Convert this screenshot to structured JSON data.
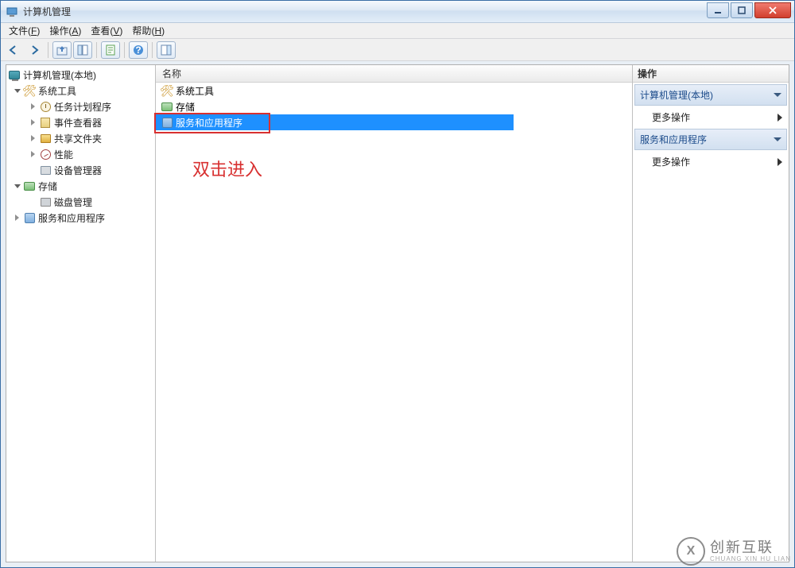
{
  "window": {
    "title": "计算机管理"
  },
  "menubar": [
    {
      "label": "文件",
      "hotkey": "F"
    },
    {
      "label": "操作",
      "hotkey": "A"
    },
    {
      "label": "查看",
      "hotkey": "V"
    },
    {
      "label": "帮助",
      "hotkey": "H"
    }
  ],
  "tree": {
    "root": "计算机管理(本地)",
    "nodes": [
      {
        "label": "系统工具",
        "expanded": true,
        "icon": "tools",
        "children": [
          {
            "label": "任务计划程序",
            "icon": "clock",
            "hasChildren": true
          },
          {
            "label": "事件查看器",
            "icon": "event",
            "hasChildren": true
          },
          {
            "label": "共享文件夹",
            "icon": "share",
            "hasChildren": true
          },
          {
            "label": "性能",
            "icon": "perf",
            "hasChildren": true
          },
          {
            "label": "设备管理器",
            "icon": "device",
            "hasChildren": false
          }
        ]
      },
      {
        "label": "存储",
        "expanded": true,
        "icon": "storage",
        "children": [
          {
            "label": "磁盘管理",
            "icon": "disk",
            "hasChildren": false
          }
        ]
      },
      {
        "label": "服务和应用程序",
        "expanded": false,
        "icon": "services",
        "hasChildren": true
      }
    ]
  },
  "list": {
    "header": "名称",
    "items": [
      {
        "label": "系统工具",
        "icon": "tools",
        "selected": false
      },
      {
        "label": "存储",
        "icon": "storage",
        "selected": false
      },
      {
        "label": "服务和应用程序",
        "icon": "services",
        "selected": true
      }
    ]
  },
  "annotation": "双击进入",
  "actions": {
    "header": "操作",
    "sections": [
      {
        "title": "计算机管理(本地)",
        "items": [
          "更多操作"
        ]
      },
      {
        "title": "服务和应用程序",
        "items": [
          "更多操作"
        ]
      }
    ]
  },
  "watermark": {
    "logo": "X",
    "cn": "创新互联",
    "en": "CHUANG XIN HU LIAN"
  }
}
